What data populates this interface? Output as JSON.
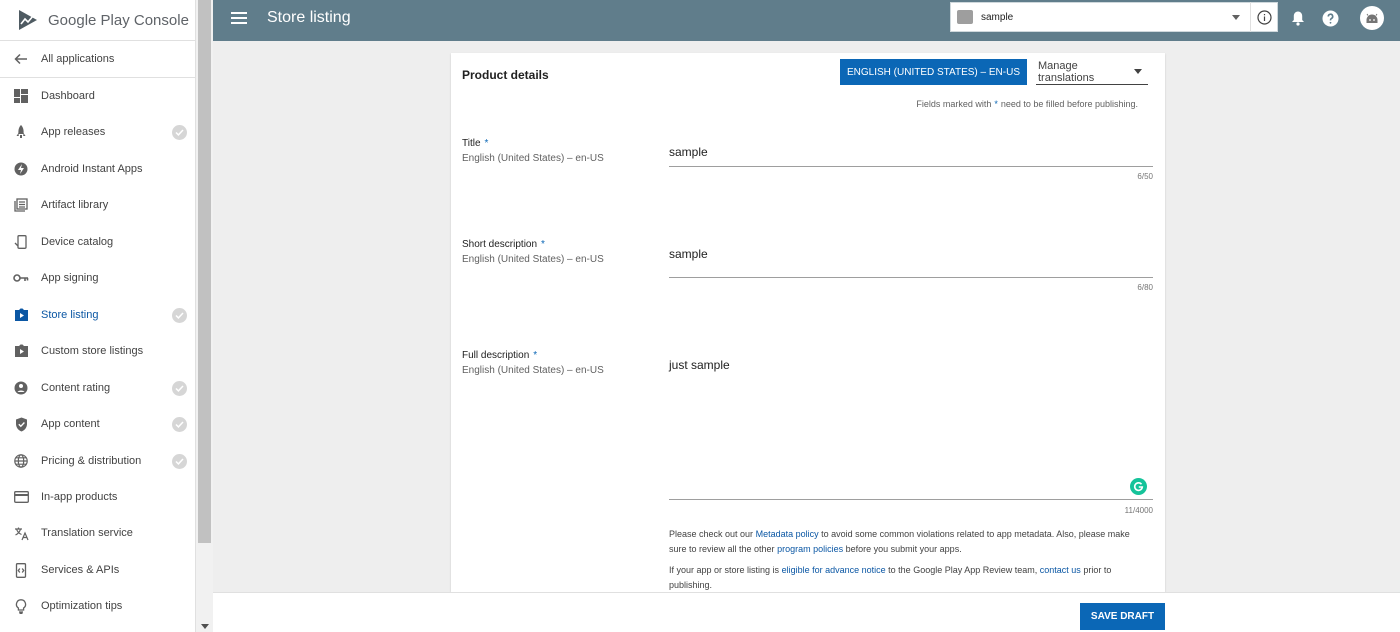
{
  "brand": {
    "name": "Google Play Console",
    "logo_icon": "play-console-logo-icon"
  },
  "sidebar": {
    "back_label": "All applications",
    "items": [
      {
        "label": "Dashboard",
        "icon": "dashboard-icon",
        "checked": false
      },
      {
        "label": "App releases",
        "icon": "rocket-icon",
        "checked": true
      },
      {
        "label": "Android Instant Apps",
        "icon": "instant-apps-icon",
        "checked": false
      },
      {
        "label": "Artifact library",
        "icon": "library-icon",
        "checked": false
      },
      {
        "label": "Device catalog",
        "icon": "device-icon",
        "checked": false
      },
      {
        "label": "App signing",
        "icon": "key-icon",
        "checked": false
      },
      {
        "label": "Store listing",
        "icon": "store-icon",
        "checked": true,
        "active": true
      },
      {
        "label": "Custom store listings",
        "icon": "custom-listing-icon",
        "checked": false
      },
      {
        "label": "Content rating",
        "icon": "rating-icon",
        "checked": true
      },
      {
        "label": "App content",
        "icon": "shield-icon",
        "checked": true
      },
      {
        "label": "Pricing & distribution",
        "icon": "globe-icon",
        "checked": true
      },
      {
        "label": "In-app products",
        "icon": "card-icon",
        "checked": false
      },
      {
        "label": "Translation service",
        "icon": "translate-icon",
        "checked": false
      },
      {
        "label": "Services & APIs",
        "icon": "api-icon",
        "checked": false
      },
      {
        "label": "Optimization tips",
        "icon": "bulb-icon",
        "checked": false
      }
    ]
  },
  "header": {
    "title": "Store listing",
    "app_select": "sample"
  },
  "product": {
    "title": "Product details",
    "language_button": "ENGLISH (UNITED STATES) – EN-US",
    "manage_translations": "Manage translations",
    "required_prefix": "Fields marked with",
    "required_star": "*",
    "required_suffix": "need to be filled before publishing.",
    "fields": [
      {
        "label": "Title",
        "sub": "English (United States) – en-US",
        "value": "sample",
        "counter": "6/50"
      },
      {
        "label": "Short description",
        "sub": "English (United States) – en-US",
        "value": "sample",
        "counter": "6/80"
      },
      {
        "label": "Full description",
        "sub": "English (United States) – en-US",
        "value": "just sample",
        "counter": "11/4000"
      }
    ],
    "policy": {
      "p1_a": "Please check out our",
      "p1_link1": "Metadata policy",
      "p1_b": "to avoid some common violations related to app metadata. Also, please make sure to review all the other",
      "p1_link2": "program policies",
      "p1_c": "before you submit your apps.",
      "p2_a": "If your app or store listing is",
      "p2_link1": "eligible for advance notice",
      "p2_b": "to the Google Play App Review team,",
      "p2_link2": "contact us",
      "p2_c": "prior to publishing."
    }
  },
  "footer": {
    "save_label": "SAVE DRAFT"
  },
  "colors": {
    "topbar": "#607d8b",
    "primary": "#0b67b6",
    "active_text": "#0b57a4"
  }
}
